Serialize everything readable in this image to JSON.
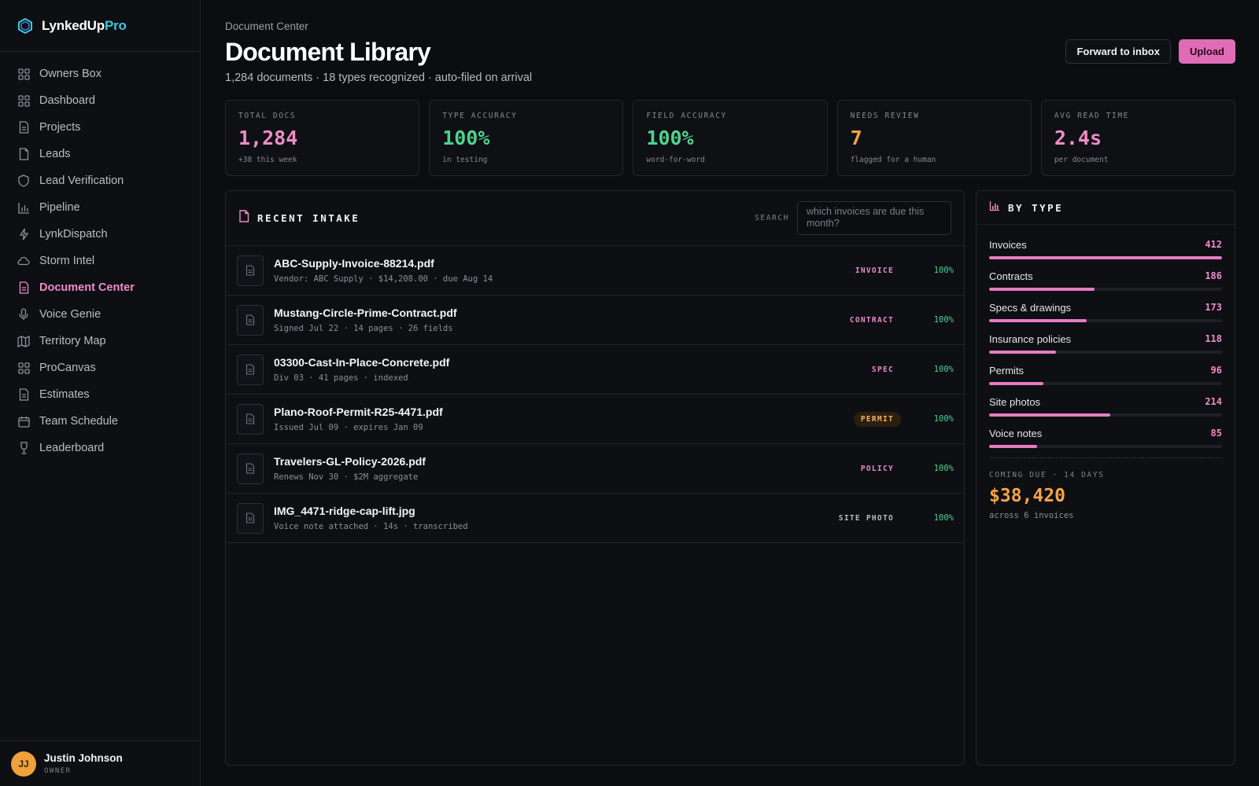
{
  "app": {
    "name_main": "LynkedUp",
    "name_accent": "Pro",
    "accent_color": "#3cc7e0",
    "brand_color": "#e06cb8"
  },
  "sidebar": {
    "items": [
      {
        "label": "Owners Box",
        "icon": "grid-icon"
      },
      {
        "label": "Dashboard",
        "icon": "grid-icon"
      },
      {
        "label": "Projects",
        "icon": "document-icon"
      },
      {
        "label": "Leads",
        "icon": "file-icon"
      },
      {
        "label": "Lead Verification",
        "icon": "shield-icon"
      },
      {
        "label": "Pipeline",
        "icon": "bar-chart-icon"
      },
      {
        "label": "LynkDispatch",
        "icon": "lightning-icon"
      },
      {
        "label": "Storm Intel",
        "icon": "cloud-icon"
      },
      {
        "label": "Document Center",
        "icon": "document-icon",
        "active": true
      },
      {
        "label": "Voice Genie",
        "icon": "microphone-icon"
      },
      {
        "label": "Territory Map",
        "icon": "map-icon"
      },
      {
        "label": "ProCanvas",
        "icon": "grid-icon"
      },
      {
        "label": "Estimates",
        "icon": "document-icon"
      },
      {
        "label": "Team Schedule",
        "icon": "calendar-icon"
      },
      {
        "label": "Leaderboard",
        "icon": "trophy-icon"
      }
    ]
  },
  "user": {
    "initials": "JJ",
    "name": "Justin Johnson",
    "role": "OWNER"
  },
  "header": {
    "breadcrumb": "Document Center",
    "title": "Document Library",
    "subtitle": "1,284 documents · 18 types recognized · auto-filed on arrival",
    "forward_label": "Forward to inbox",
    "upload_label": "Upload"
  },
  "stats": [
    {
      "label": "TOTAL DOCS",
      "value": "1,284",
      "note": "+38 this week",
      "color": "#f08cc8"
    },
    {
      "label": "TYPE ACCURACY",
      "value": "100%",
      "note": "in testing",
      "color": "#4fd28f"
    },
    {
      "label": "FIELD ACCURACY",
      "value": "100%",
      "note": "word-for-word",
      "color": "#4fd28f"
    },
    {
      "label": "NEEDS REVIEW",
      "value": "7",
      "note": "flagged for a human",
      "color": "#f5a447"
    },
    {
      "label": "AVG READ TIME",
      "value": "2.4s",
      "note": "per document",
      "color": "#f08cc8"
    }
  ],
  "intake": {
    "title": "RECENT INTAKE",
    "search_label": "SEARCH",
    "search_placeholder": "which invoices are due this month?",
    "documents": [
      {
        "name": "ABC-Supply-Invoice-88214.pdf",
        "meta": "Vendor: ABC Supply · $14,208.00 · due Aug 14",
        "type": "INVOICE",
        "accuracy": "100%"
      },
      {
        "name": "Mustang-Circle-Prime-Contract.pdf",
        "meta": "Signed Jul 22 · 14 pages · 26 fields",
        "type": "CONTRACT",
        "accuracy": "100%"
      },
      {
        "name": "03300-Cast-In-Place-Concrete.pdf",
        "meta": "Div 03 · 41 pages · indexed",
        "type": "SPEC",
        "accuracy": "100%"
      },
      {
        "name": "Plano-Roof-Permit-R25-4471.pdf",
        "meta": "Issued Jul 09 · expires Jan 09",
        "type": "PERMIT",
        "accuracy": "100%"
      },
      {
        "name": "Travelers-GL-Policy-2026.pdf",
        "meta": "Renews Nov 30 · $2M aggregate",
        "type": "POLICY",
        "accuracy": "100%"
      },
      {
        "name": "IMG_4471-ridge-cap-lift.jpg",
        "meta": "Voice note attached · 14s · transcribed",
        "type": "SITE PHOTO",
        "accuracy": "100%"
      }
    ]
  },
  "by_type": {
    "title": "BY TYPE",
    "max": 412,
    "items": [
      {
        "name": "Invoices",
        "count": 412
      },
      {
        "name": "Contracts",
        "count": 186
      },
      {
        "name": "Specs & drawings",
        "count": 173
      },
      {
        "name": "Insurance policies",
        "count": 118
      },
      {
        "name": "Permits",
        "count": 96
      },
      {
        "name": "Site photos",
        "count": 214
      },
      {
        "name": "Voice notes",
        "count": 85
      }
    ],
    "due_label": "COMING DUE · 14 DAYS",
    "due_amount": "$38,420",
    "due_note": "across 6 invoices"
  }
}
